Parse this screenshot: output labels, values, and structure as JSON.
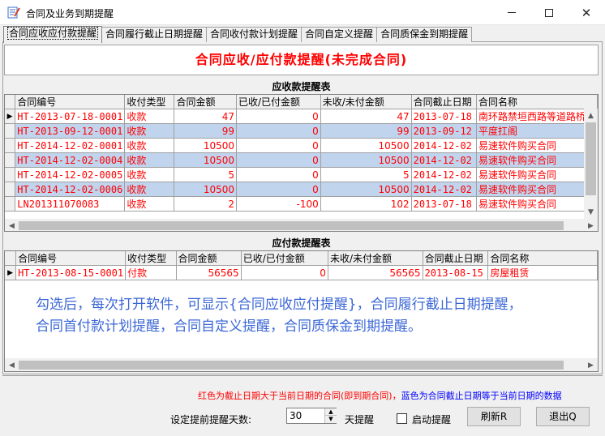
{
  "window": {
    "title": "合同及业务到期提醒",
    "minimize": "—",
    "maximize": "☐",
    "close": "✕"
  },
  "tabs": [
    {
      "label": "合同应收应付款提醒"
    },
    {
      "label": "合同履行截止日期提醒"
    },
    {
      "label": "合同收付款计划提醒"
    },
    {
      "label": "合同自定义提醒"
    },
    {
      "label": "合同质保金到期提醒"
    }
  ],
  "main_title": "合同应收/应付款提醒(未完成合同)",
  "receivable": {
    "title": "应收款提醒表",
    "columns": [
      "合同编号",
      "收付类型",
      "合同金额",
      "已收/已付金额",
      "未收/未付金额",
      "合同截止日期",
      "合同名称"
    ],
    "rows": [
      {
        "indicator": "▶",
        "no": "HT-2013-07-18-0001",
        "type": "收款",
        "amount": "47",
        "paid": "0",
        "unpaid": "47",
        "due": "2013-07-18",
        "name": "南环路禁垣西路等道路桥梁",
        "color": "red"
      },
      {
        "indicator": "",
        "no": "HT-2013-09-12-0001",
        "type": "收款",
        "amount": "99",
        "paid": "0",
        "unpaid": "99",
        "due": "2013-09-12",
        "name": "平度扛阁",
        "color": "blue"
      },
      {
        "indicator": "",
        "no": "HT-2014-12-02-0001",
        "type": "收款",
        "amount": "10500",
        "paid": "0",
        "unpaid": "10500",
        "due": "2014-12-02",
        "name": "易速软件购买合同",
        "color": "red"
      },
      {
        "indicator": "",
        "no": "HT-2014-12-02-0004",
        "type": "收款",
        "amount": "10500",
        "paid": "0",
        "unpaid": "10500",
        "due": "2014-12-02",
        "name": "易速软件购买合同",
        "color": "blue"
      },
      {
        "indicator": "",
        "no": "HT-2014-12-02-0005",
        "type": "收款",
        "amount": "5",
        "paid": "0",
        "unpaid": "5",
        "due": "2014-12-02",
        "name": "易速软件购买合同",
        "color": "red"
      },
      {
        "indicator": "",
        "no": "HT-2014-12-02-0006",
        "type": "收款",
        "amount": "10500",
        "paid": "0",
        "unpaid": "10500",
        "due": "2014-12-02",
        "name": "易速软件购买合同",
        "color": "blue"
      },
      {
        "indicator": "",
        "no": "LN201311070083",
        "type": "收款",
        "amount": "2",
        "paid": "-100",
        "unpaid": "102",
        "due": "2013-07-18",
        "name": "易速软件购买合同",
        "color": "red"
      }
    ]
  },
  "payable": {
    "title": "应付款提醒表",
    "columns": [
      "合同编号",
      "收付类型",
      "合同金额",
      "已收/已付金额",
      "未收/未付金额",
      "合同截止日期",
      "合同名称"
    ],
    "rows": [
      {
        "indicator": "▶",
        "no": "HT-2013-08-15-0001",
        "type": "付款",
        "amount": "56565",
        "paid": "0",
        "unpaid": "56565",
        "due": "2013-08-15",
        "name": "房屋租赁",
        "color": "red"
      }
    ]
  },
  "note": {
    "line1": "勾选后，每次打开软件，可显示{合同应收应付提醒}，合同履行截止日期提醒，",
    "line2": "合同首付款计划提醒，合同自定义提醒，合同质保金到期提醒。"
  },
  "legend": {
    "red_text": "红色为截止日期大于当前日期的合同(即到期合同)，",
    "blue_text": "蓝色为合同截止日期等于当前日期的数据",
    "red": "#ff0000",
    "blue": "#0000ff"
  },
  "controls": {
    "days_label": "设定提前提醒天数:",
    "days_value": "30",
    "days_unit": "天提醒",
    "startup_label": "启动提醒",
    "refresh_label": "刷新R",
    "exit_label": "退出Q"
  }
}
